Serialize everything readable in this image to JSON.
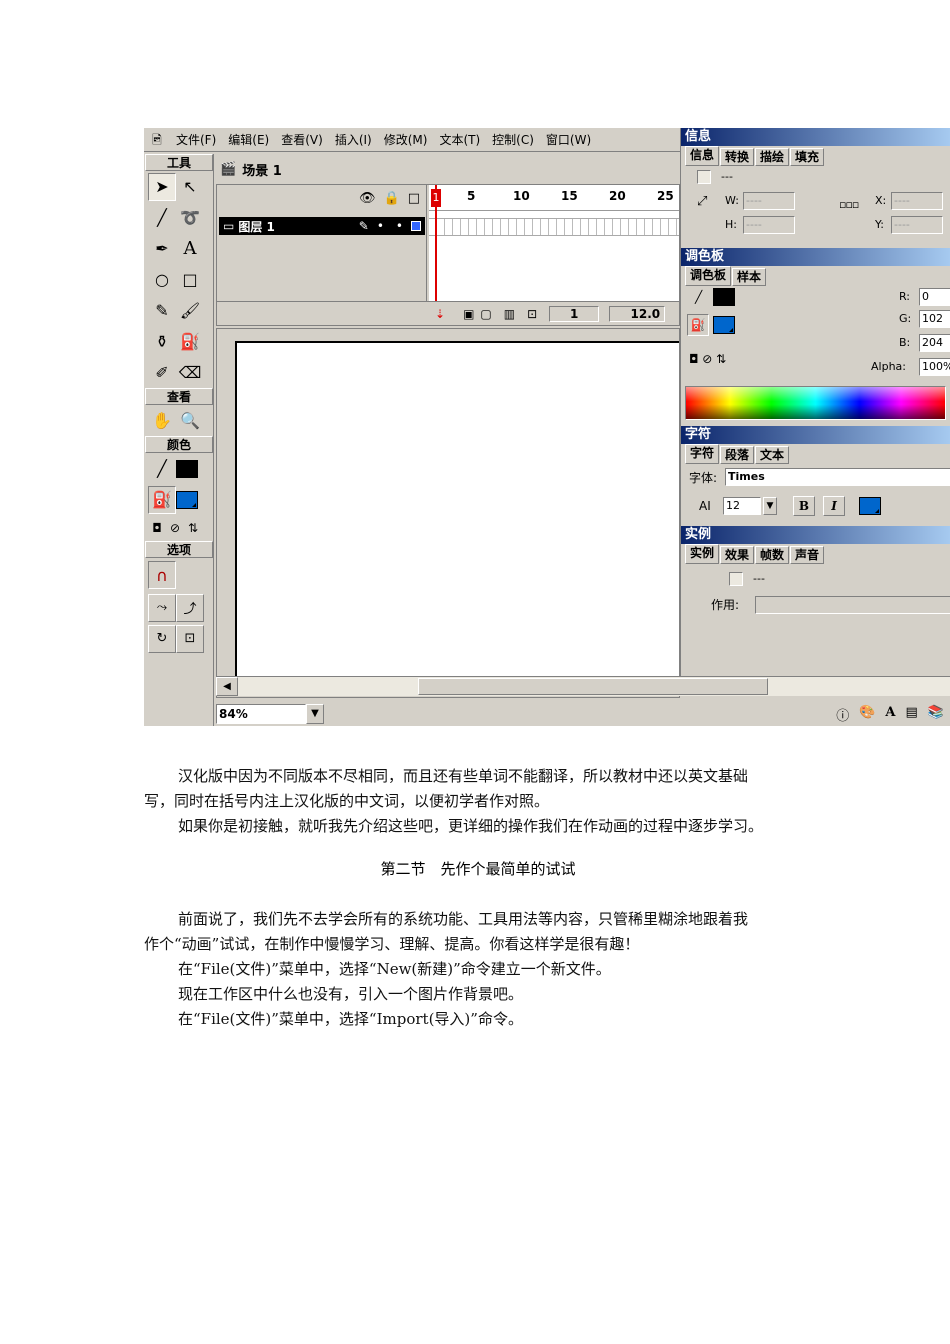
{
  "menubar": {
    "app_icon": "flash-app-icon",
    "items": [
      "文件(F)",
      "编辑(E)",
      "查看(V)",
      "插入(I)",
      "修改(M)",
      "文本(T)",
      "控制(C)",
      "窗口(W)"
    ]
  },
  "tools": {
    "header_tools": "工具",
    "header_view": "查看",
    "header_colors": "颜色",
    "header_options": "选项"
  },
  "scene": {
    "label": "场景 1"
  },
  "timeline": {
    "layer_name": "图层 1",
    "frame_numbers": [
      "1",
      "5",
      "10",
      "15",
      "20",
      "25"
    ],
    "current_frame": "1",
    "frame_rate": "12.0"
  },
  "status": {
    "zoom": "84%"
  },
  "info_panel": {
    "title": "信息",
    "tabs": [
      "信息",
      "转换",
      "描绘",
      "填充"
    ],
    "placeholder": "---",
    "w_label": "W:",
    "h_label": "H:",
    "x_label": "X:",
    "y_label": "Y:",
    "w_value": "----",
    "h_value": "----",
    "x_value": "----",
    "y_value": "----"
  },
  "color_panel": {
    "title": "调色板",
    "tabs": [
      "调色板",
      "样本"
    ],
    "r_label": "R:",
    "g_label": "G:",
    "b_label": "B:",
    "alpha_label": "Alpha:",
    "r_value": "0",
    "g_value": "102",
    "b_value": "204",
    "alpha_value": "100%",
    "stroke_color": "#000000",
    "fill_color": "#0066cc"
  },
  "char_panel": {
    "title": "字符",
    "tabs": [
      "字符",
      "段落",
      "文本"
    ],
    "font_label": "字体:",
    "font_value": "Times",
    "size_label": "AI",
    "size_value": "12",
    "bold": "B",
    "italic": "I"
  },
  "instance_panel": {
    "title": "实例",
    "tabs": [
      "实例",
      "效果",
      "帧数",
      "声音"
    ],
    "placeholder": "---",
    "action_label": "作用:"
  },
  "text": {
    "p1_line1": "汉化版中因为不同版本不尽相同，而且还有些单词不能翻译，所以教材中还以英文基础",
    "p1_line2": "写，同时在括号内注上汉化版的中文词，以便初学者作对照。",
    "p2": "如果你是初接触，就听我先介绍这些吧，更详细的操作我们在作动画的过程中逐步学习。",
    "section_title": "第二节　先作个最简单的试试",
    "p3_line1": "前面说了，我们先不去学会所有的系统功能、工具用法等内容，只管稀里糊涂地跟着我",
    "p3_line2": "作个“动画”试试，在制作中慢慢学习、理解、提高。你看这样学是很有趣！",
    "p4": "在“File(文件)”菜单中，选择“New(新建)”命令建立一个新文件。",
    "p5": "现在工作区中什么也没有，引入一个图片作背景吧。",
    "p6": "在“File(文件)”菜单中，选择“Import(导入)”命令。"
  }
}
